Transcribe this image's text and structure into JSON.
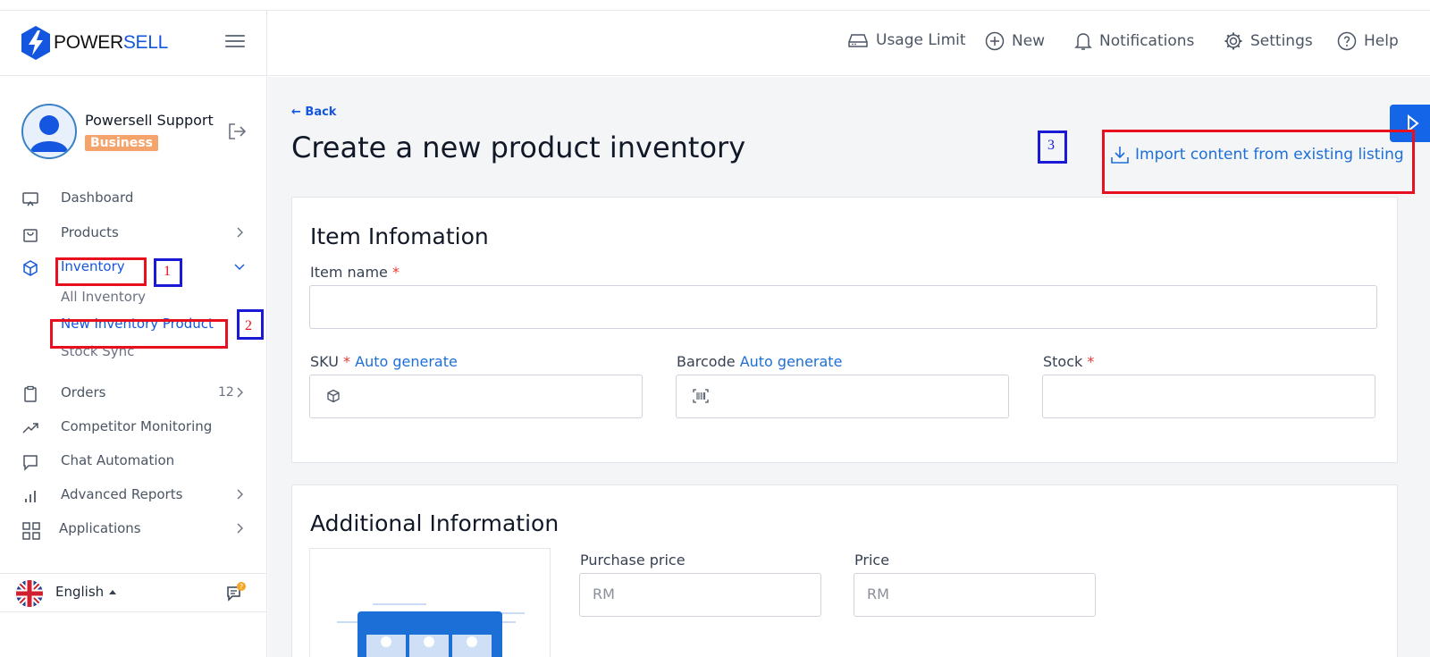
{
  "brand": {
    "prefix": "POWER",
    "suffix": "SELL"
  },
  "profile": {
    "name": "Powersell Support",
    "plan": "Business"
  },
  "nav": {
    "dashboard": "Dashboard",
    "products": "Products",
    "inventory": "Inventory",
    "inventory_sub": [
      "All Inventory",
      "New Inventory Product",
      "Stock Sync"
    ],
    "orders": "Orders",
    "orders_count": "12",
    "competitor": "Competitor Monitoring",
    "chat": "Chat Automation",
    "reports": "Advanced Reports",
    "applications": "Applications"
  },
  "footer": {
    "language": "English"
  },
  "topbar": {
    "usage_limit": "Usage Limit",
    "new": "New",
    "notifications": "Notifications",
    "settings": "Settings",
    "help": "Help"
  },
  "page": {
    "back": "Back",
    "title": "Create a new product inventory",
    "import_link": "Import content from existing listing"
  },
  "item_info": {
    "heading": "Item Infomation",
    "item_name_label": "Item name",
    "sku_label": "SKU",
    "barcode_label": "Barcode",
    "stock_label": "Stock",
    "auto_generate": "Auto generate",
    "required_mark": "*"
  },
  "additional_info": {
    "heading": "Additional Information",
    "purchase_price_label": "Purchase price",
    "price_label": "Price",
    "currency_placeholder": "RM"
  },
  "annotations": [
    "1",
    "2",
    "3"
  ],
  "colors": {
    "accent": "#1456e0",
    "badge": "#f4a36a",
    "annotation_red": "#e8101e",
    "annotation_blue": "#1a1ad6"
  }
}
